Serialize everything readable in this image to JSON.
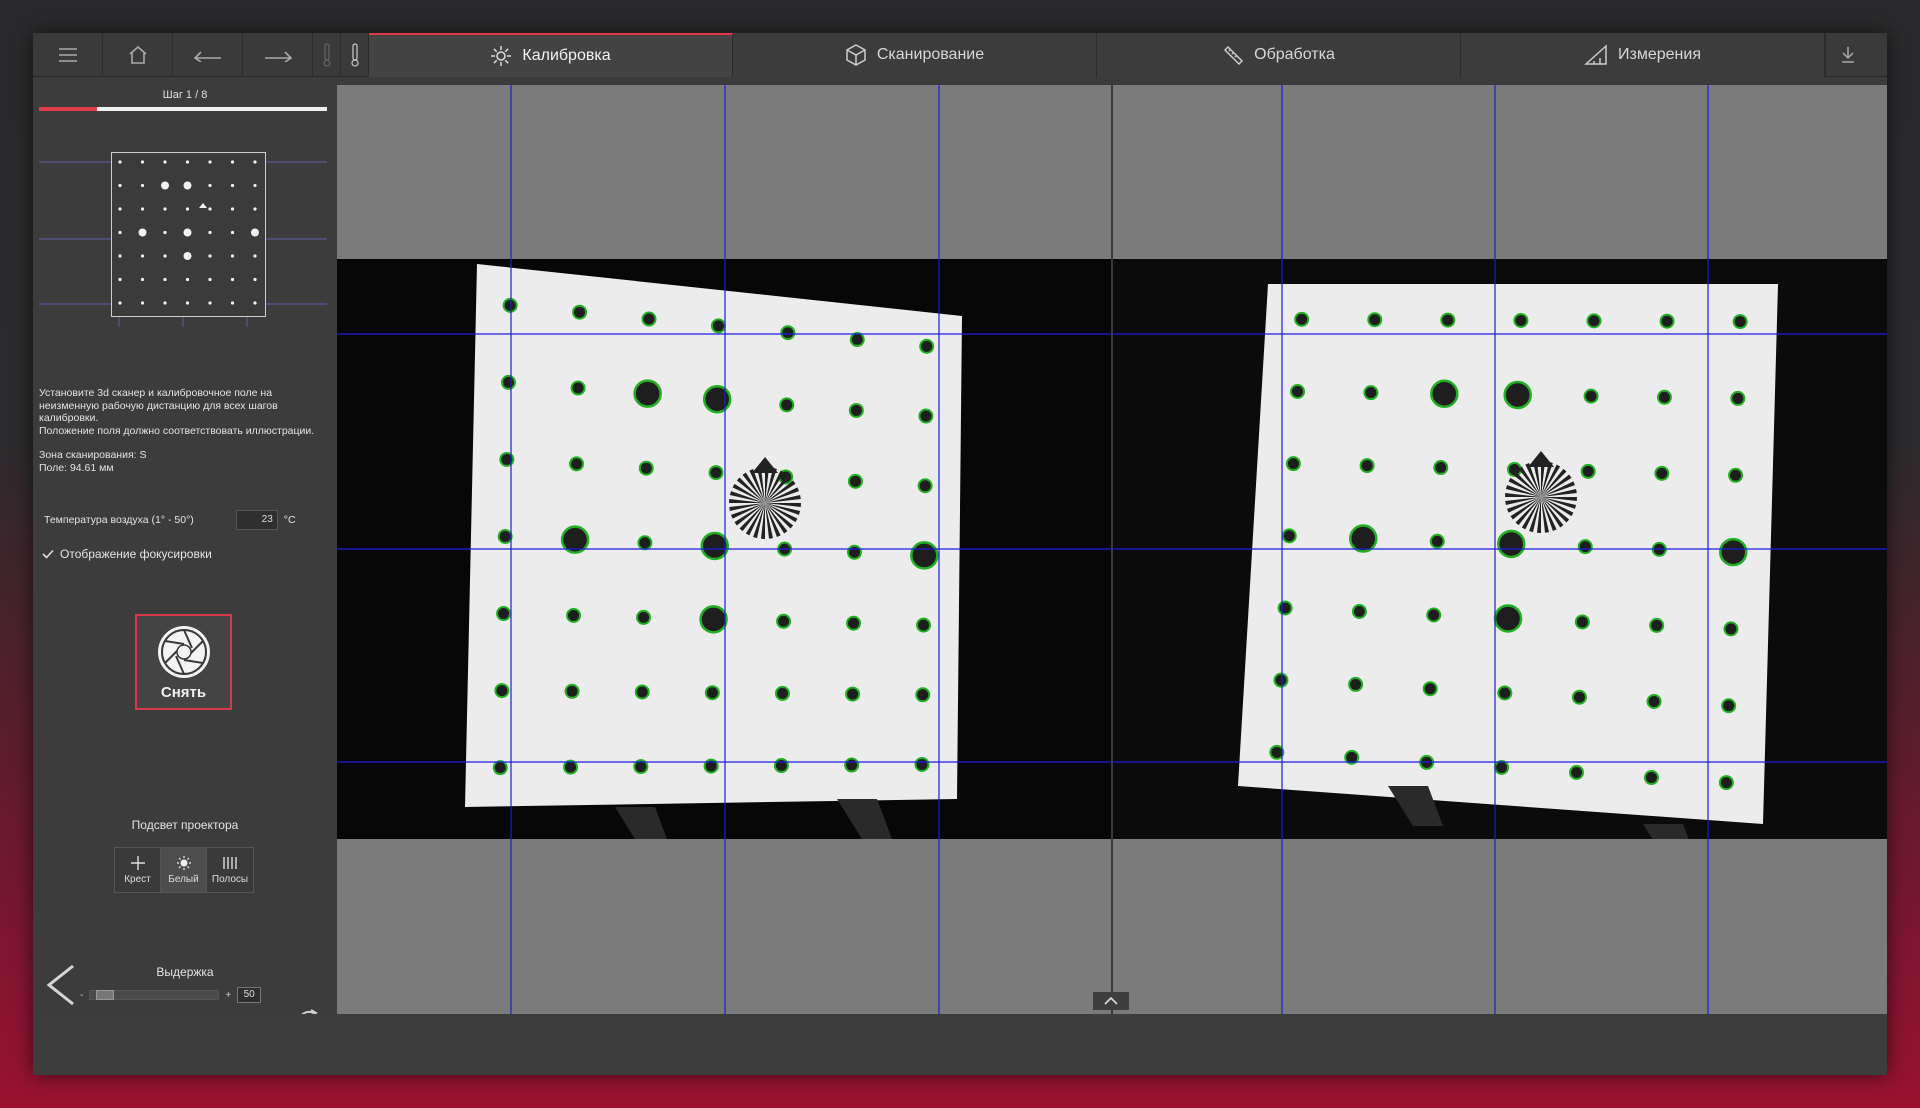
{
  "toolbar": {
    "tabs": [
      {
        "label": "Калибровка",
        "icon": "gear-icon",
        "active": true
      },
      {
        "label": "Сканирование",
        "icon": "cube-icon",
        "active": false
      },
      {
        "label": "Обработка",
        "icon": "ruler-icon",
        "active": false
      },
      {
        "label": "Измерения",
        "icon": "triangle-ruler-icon",
        "active": false
      }
    ],
    "icons": [
      "menu-icon",
      "home-icon",
      "undo-icon",
      "redo-icon",
      "thermometer-low-icon",
      "thermometer-high-icon",
      "download-icon"
    ]
  },
  "sidebar": {
    "step_label": "Шаг 1 / 8",
    "step_progress": 0.2,
    "instructions": [
      "Установите 3d сканер и калибровочное поле на",
      "неизменную рабочую дистанцию для всех шагов",
      "калибровки.",
      "Положение поля должно соответствовать иллюстрации."
    ],
    "zone_line": "Зона сканирования:  S",
    "field_line": "Поле:  94.61 мм",
    "temperature": {
      "label": "Температура воздуха (1° - 50°)",
      "value": "23",
      "unit": "°C"
    },
    "focus_display": {
      "label": "Отображение фокусировки",
      "checked": true
    },
    "shoot_button": "Снять",
    "projector": {
      "title": "Подсвет проектора",
      "buttons": [
        {
          "label": "Крест",
          "icon": "cross-icon"
        },
        {
          "label": "Белый",
          "icon": "sun-icon",
          "active": true
        },
        {
          "label": "Полосы",
          "icon": "stripes-icon"
        }
      ]
    },
    "exposure": {
      "title": "Выдержка",
      "minus": "-",
      "plus": "+",
      "value": "50",
      "level": 0.05
    }
  },
  "colors": {
    "accent": "#e23c4b",
    "grid_line": "#1c1ce0",
    "marker_ring": "#21b021"
  }
}
